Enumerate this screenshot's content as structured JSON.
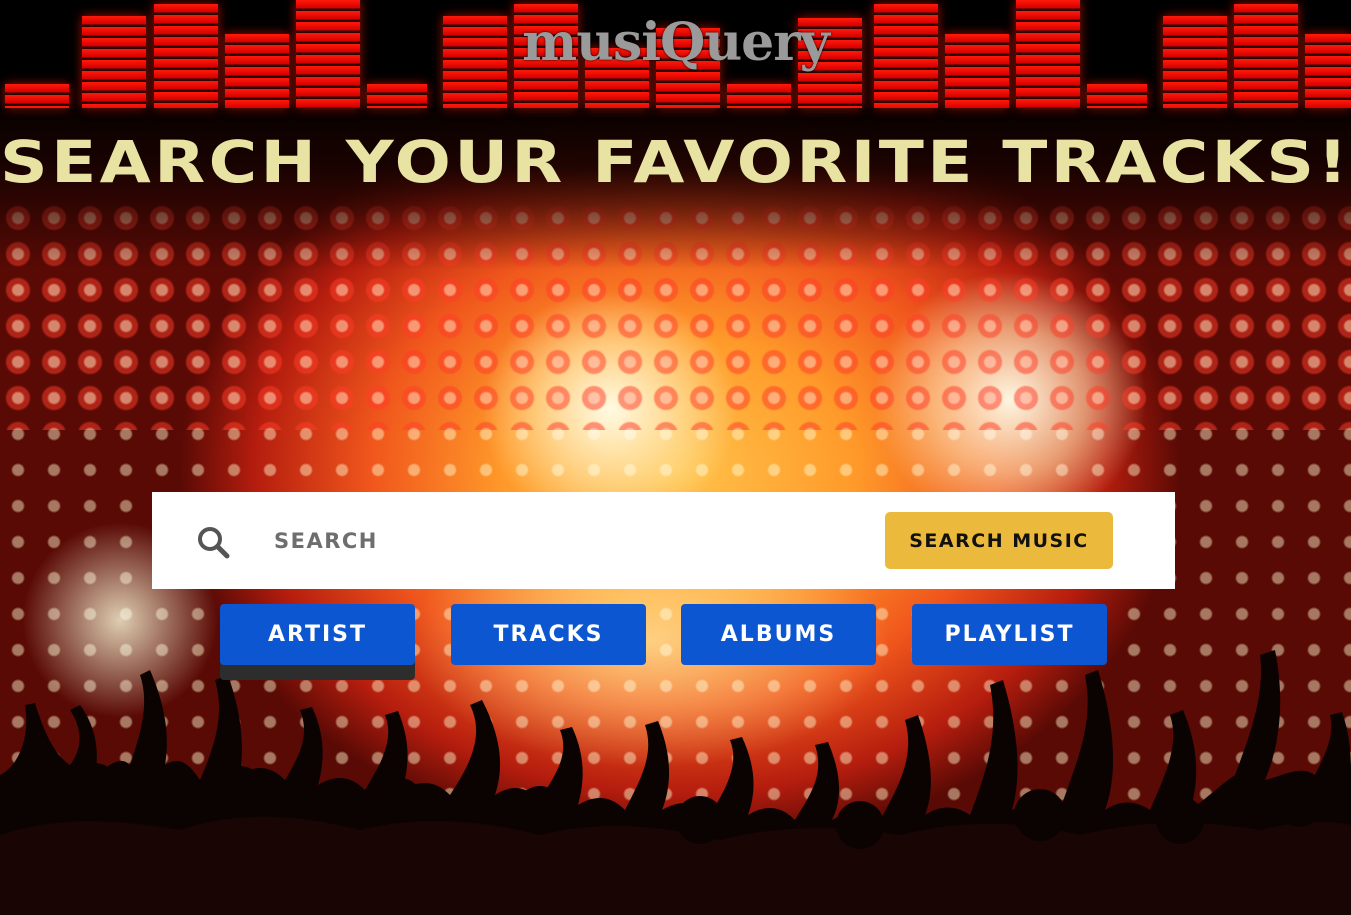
{
  "header": {
    "logo": "musiQuery"
  },
  "hero": {
    "headline": "Search Your Favorite Tracks!"
  },
  "search": {
    "placeholder": "SEARCH",
    "value": "",
    "icon": "search-icon",
    "button_label": "Search Music"
  },
  "categories": {
    "active": "Artist",
    "items": [
      {
        "label": "Artist"
      },
      {
        "label": "Tracks"
      },
      {
        "label": "Albums"
      },
      {
        "label": "Playlist"
      }
    ]
  },
  "colors": {
    "headline": "#e8e3a2",
    "logo": "#9a9a9a",
    "search_button": "#ebb93c",
    "category_button": "#0d56d1",
    "active_underline": "#2d2d2d"
  }
}
